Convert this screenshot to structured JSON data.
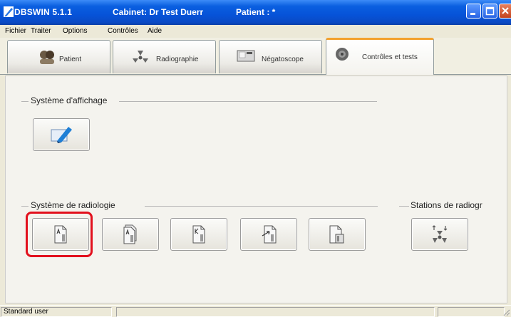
{
  "window": {
    "app_title": "DBSWIN 5.1.1",
    "cabinet_title": "Cabinet: Dr Test Duerr",
    "patient_title": "Patient : *",
    "controls": [
      "minimize-icon",
      "maximize-icon",
      "close-icon"
    ]
  },
  "menu": {
    "items": [
      {
        "label": "Fichier"
      },
      {
        "label": "Traiter"
      },
      {
        "label": "Options"
      },
      {
        "label": "Contrôles"
      },
      {
        "label": "Aide"
      }
    ]
  },
  "tabs": [
    {
      "label": "Patient",
      "icon": "patient-icon",
      "active": false
    },
    {
      "label": "Radiographie",
      "icon": "radiation-icon",
      "active": false
    },
    {
      "label": "Négatoscope",
      "icon": "viewer-icon",
      "active": false
    },
    {
      "label": "Contrôles et tests",
      "icon": "test-icon",
      "active": true
    }
  ],
  "groups": {
    "display": {
      "label": "Système d'affichage"
    },
    "radiology": {
      "label": "Système de radiologie"
    },
    "stations": {
      "label": "Stations de radiogr"
    }
  },
  "status": {
    "user": "Standard user"
  },
  "colors": {
    "title_bar": "#0a5fe0",
    "active_tab_accent": "#f3a12f",
    "highlight": "#e2101d"
  }
}
